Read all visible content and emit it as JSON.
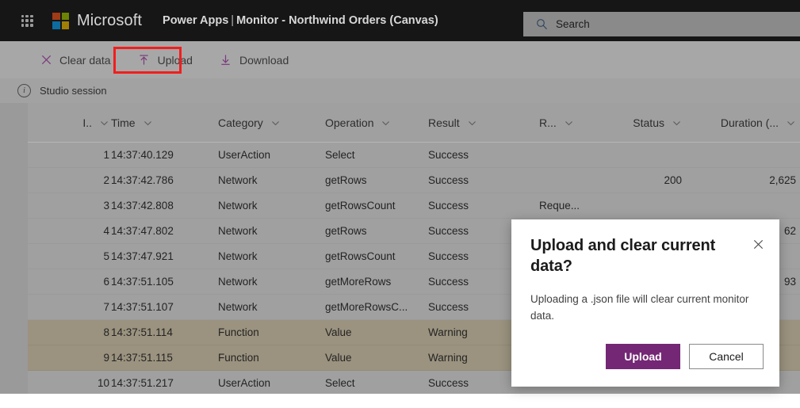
{
  "suite": {
    "waffle_label": "app-launcher",
    "brand": "Microsoft",
    "app_name": "Power Apps",
    "separator": "|",
    "app_context": "Monitor - Northwind Orders (Canvas)",
    "search_placeholder": "Search"
  },
  "command_bar": {
    "items": [
      {
        "label": "Clear data",
        "icon": "close-x-icon"
      },
      {
        "label": "Upload",
        "icon": "upload-arrow-icon"
      },
      {
        "label": "Download",
        "icon": "download-arrow-icon"
      }
    ],
    "highlighted": "Upload",
    "highlight_color": "#f31d1d"
  },
  "session": {
    "icon": "info-icon",
    "label": "Studio session"
  },
  "table": {
    "columns": [
      {
        "key": "index",
        "label": "I..",
        "align": "right"
      },
      {
        "key": "time",
        "label": "Time",
        "align": "left"
      },
      {
        "key": "category",
        "label": "Category",
        "align": "left"
      },
      {
        "key": "operation",
        "label": "Operation",
        "align": "left"
      },
      {
        "key": "result",
        "label": "Result",
        "align": "left"
      },
      {
        "key": "r",
        "label": "R...",
        "align": "left"
      },
      {
        "key": "status",
        "label": "Status",
        "align": "right"
      },
      {
        "key": "duration",
        "label": "Duration (...",
        "align": "right"
      }
    ],
    "rows": [
      {
        "index": "1",
        "time": "14:37:40.129",
        "category": "UserAction",
        "operation": "Select",
        "result": "Success",
        "r": "",
        "status": "",
        "duration": "",
        "warning": false
      },
      {
        "index": "2",
        "time": "14:37:42.786",
        "category": "Network",
        "operation": "getRows",
        "result": "Success",
        "r": "",
        "status": "200",
        "duration": "2,625",
        "warning": false
      },
      {
        "index": "3",
        "time": "14:37:42.808",
        "category": "Network",
        "operation": "getRowsCount",
        "result": "Success",
        "r": "Reque...",
        "status": "",
        "duration": "",
        "warning": false
      },
      {
        "index": "4",
        "time": "14:37:47.802",
        "category": "Network",
        "operation": "getRows",
        "result": "Success",
        "r": "",
        "status": "",
        "duration": "62",
        "warning": false
      },
      {
        "index": "5",
        "time": "14:37:47.921",
        "category": "Network",
        "operation": "getRowsCount",
        "result": "Success",
        "r": "",
        "status": "",
        "duration": "",
        "warning": false
      },
      {
        "index": "6",
        "time": "14:37:51.105",
        "category": "Network",
        "operation": "getMoreRows",
        "result": "Success",
        "r": "",
        "status": "",
        "duration": "93",
        "warning": false
      },
      {
        "index": "7",
        "time": "14:37:51.107",
        "category": "Network",
        "operation": "getMoreRowsC...",
        "result": "Success",
        "r": "",
        "status": "",
        "duration": "",
        "warning": false
      },
      {
        "index": "8",
        "time": "14:37:51.114",
        "category": "Function",
        "operation": "Value",
        "result": "Warning",
        "r": "",
        "status": "",
        "duration": "",
        "warning": true
      },
      {
        "index": "9",
        "time": "14:37:51.115",
        "category": "Function",
        "operation": "Value",
        "result": "Warning",
        "r": "",
        "status": "",
        "duration": "",
        "warning": true
      },
      {
        "index": "10",
        "time": "14:37:51.217",
        "category": "UserAction",
        "operation": "Select",
        "result": "Success",
        "r": "",
        "status": "",
        "duration": "",
        "warning": false
      }
    ],
    "warning_row_color": "#9b937f",
    "row_color": "#a0a0a0"
  },
  "dialog": {
    "title": "Upload and clear current data?",
    "body": "Uploading a .json file will clear current monitor data.",
    "close_icon": "close-icon",
    "primary_button": "Upload",
    "secondary_button": "Cancel",
    "primary_color": "#742774"
  }
}
